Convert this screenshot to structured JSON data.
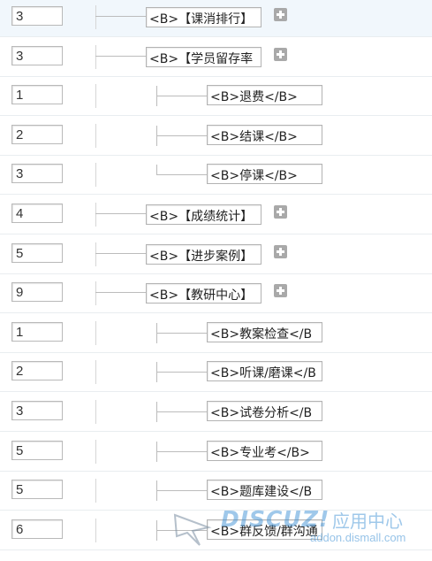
{
  "rows": [
    {
      "order": "3",
      "name": "<B>【课消排行】",
      "level": 1,
      "has_add": true,
      "highlight": true
    },
    {
      "order": "3",
      "name": "<B>【学员留存率",
      "level": 1,
      "has_add": true
    },
    {
      "order": "1",
      "name": "<B>退费</B>",
      "level": 2
    },
    {
      "order": "2",
      "name": "<B>结课</B>",
      "level": 2
    },
    {
      "order": "3",
      "name": "<B>停课</B>",
      "level": 2,
      "last_child": true
    },
    {
      "order": "4",
      "name": "<B>【成绩统计】",
      "level": 1,
      "has_add": true
    },
    {
      "order": "5",
      "name": "<B>【进步案例】",
      "level": 1,
      "has_add": true
    },
    {
      "order": "9",
      "name": "<B>【教研中心】",
      "level": 1,
      "has_add": true
    },
    {
      "order": "1",
      "name": "<B>教案检查</B",
      "level": 2
    },
    {
      "order": "2",
      "name": "<B>听课/磨课</B",
      "level": 2
    },
    {
      "order": "3",
      "name": "<B>试卷分析</B",
      "level": 2
    },
    {
      "order": "5",
      "name": "<B>专业考</B>",
      "level": 2
    },
    {
      "order": "5",
      "name": "<B>题库建设</B",
      "level": 2
    },
    {
      "order": "6",
      "name": "<B>群反馈/群沟通",
      "level": 2
    }
  ],
  "watermark": {
    "logo": "DISCUZ!",
    "cn": "应用中心",
    "url": "addon.dismall.com"
  },
  "colors": {
    "highlight_row": "#f1f7fc",
    "add_icon": "#a9a9a9",
    "watermark": "#4092d6"
  }
}
